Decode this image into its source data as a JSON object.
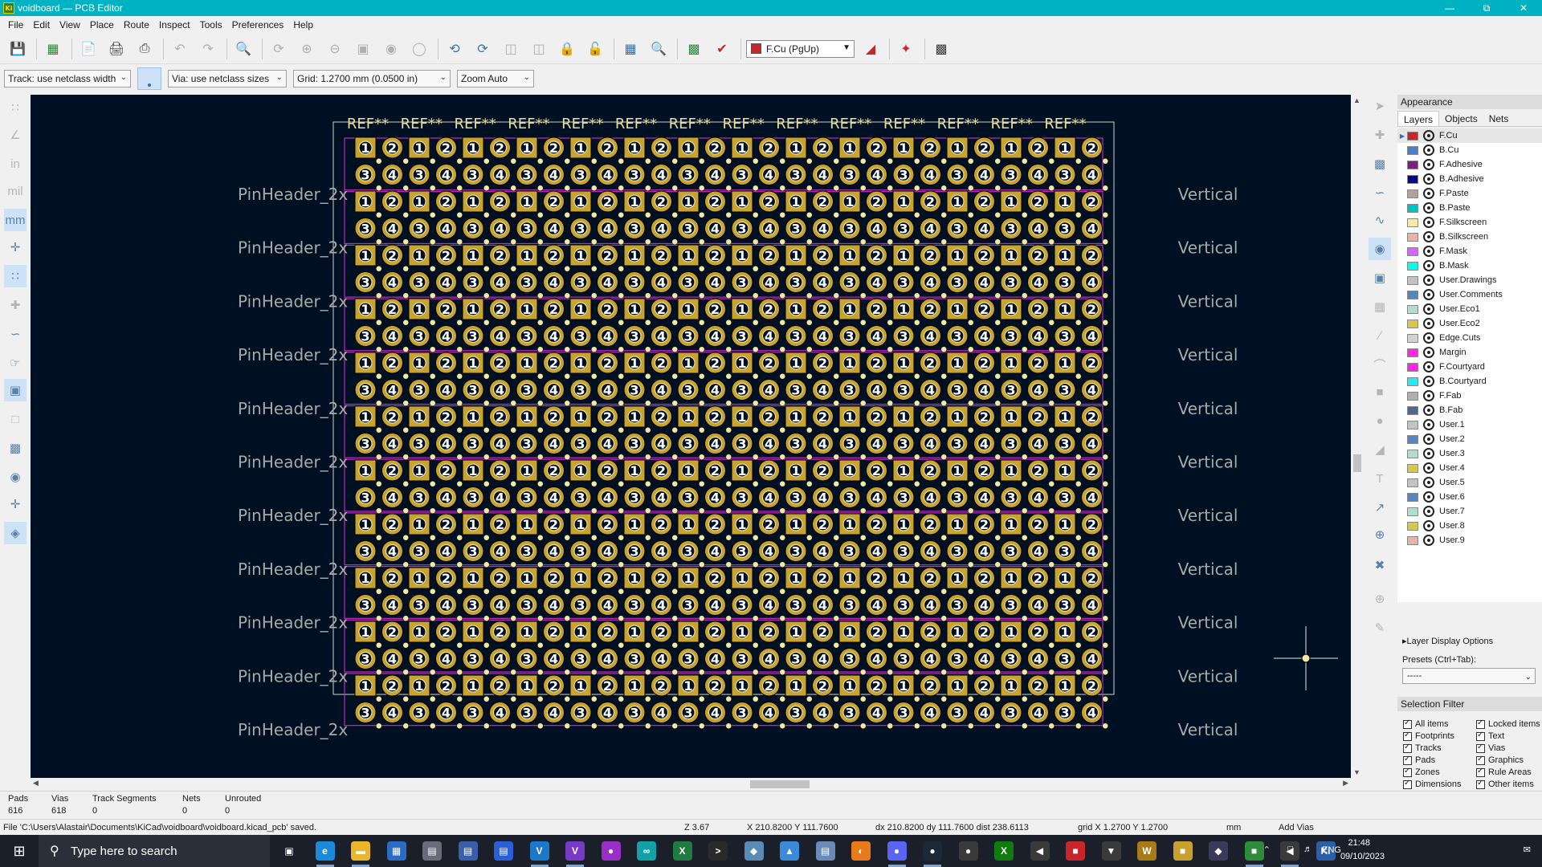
{
  "window": {
    "title": "voidboard — PCB Editor",
    "app_icon": "kicad-pcb-icon"
  },
  "menu": [
    "File",
    "Edit",
    "View",
    "Place",
    "Route",
    "Inspect",
    "Tools",
    "Preferences",
    "Help"
  ],
  "toolbar": {
    "layer_selector": "F.Cu (PgUp)"
  },
  "toolbar2": {
    "track_width": "Track: use netclass width",
    "via_size": "Via: use netclass sizes",
    "grid": "Grid: 1.2700 mm (0.0500 in)",
    "zoom": "Zoom Auto"
  },
  "board": {
    "ref_label": "REF**",
    "row_label_left": "PinHeader_2x",
    "row_label_right": "Vertical",
    "pin_numbers": [
      "1",
      "2",
      "3",
      "4"
    ],
    "colors": {
      "background": "#001023",
      "copper": "#c8a330",
      "silkscreen": "#e8dc9a",
      "courtyard": "#c02cc0",
      "fab_text": "#a8a8a8"
    }
  },
  "appearance": {
    "title": "Appearance",
    "tabs": [
      "Layers",
      "Objects",
      "Nets"
    ],
    "active_tab": "Layers",
    "layers": [
      {
        "name": "F.Cu",
        "color": "#c8262a"
      },
      {
        "name": "B.Cu",
        "color": "#4d7fc4"
      },
      {
        "name": "F.Adhesive",
        "color": "#841c80"
      },
      {
        "name": "B.Adhesive",
        "color": "#000d80"
      },
      {
        "name": "F.Paste",
        "color": "#b4a09c"
      },
      {
        "name": "B.Paste",
        "color": "#00c2c2"
      },
      {
        "name": "F.Silkscreen",
        "color": "#f2eda1"
      },
      {
        "name": "B.Silkscreen",
        "color": "#e8b2a7"
      },
      {
        "name": "F.Mask",
        "color": "#d864ff"
      },
      {
        "name": "B.Mask",
        "color": "#02ffee"
      },
      {
        "name": "User.Drawings",
        "color": "#c2c2c2"
      },
      {
        "name": "User.Comments",
        "color": "#5984c4"
      },
      {
        "name": "User.Eco1",
        "color": "#b4dbd2"
      },
      {
        "name": "User.Eco2",
        "color": "#d8c84a"
      },
      {
        "name": "Edge.Cuts",
        "color": "#d0d2cd"
      },
      {
        "name": "Margin",
        "color": "#ff26e2"
      },
      {
        "name": "F.Courtyard",
        "color": "#ff26e2"
      },
      {
        "name": "B.Courtyard",
        "color": "#26e9ff"
      },
      {
        "name": "F.Fab",
        "color": "#afafaf"
      },
      {
        "name": "B.Fab",
        "color": "#58658a"
      },
      {
        "name": "User.1",
        "color": "#c2c2c2"
      },
      {
        "name": "User.2",
        "color": "#5984c4"
      },
      {
        "name": "User.3",
        "color": "#b4dbd2"
      },
      {
        "name": "User.4",
        "color": "#d8c84a"
      },
      {
        "name": "User.5",
        "color": "#c2c2c2"
      },
      {
        "name": "User.6",
        "color": "#5984c4"
      },
      {
        "name": "User.7",
        "color": "#b4dbd2"
      },
      {
        "name": "User.8",
        "color": "#d8c84a"
      },
      {
        "name": "User.9",
        "color": "#e8b2a7"
      }
    ],
    "layer_display_options": "Layer Display Options",
    "presets_label": "Presets (Ctrl+Tab):",
    "presets_value": "-----"
  },
  "selection_filter": {
    "title": "Selection Filter",
    "left": [
      "All items",
      "Footprints",
      "Tracks",
      "Pads",
      "Zones",
      "Dimensions"
    ],
    "right": [
      "Locked items",
      "Text",
      "Vias",
      "Graphics",
      "Rule Areas",
      "Other items"
    ]
  },
  "stats": {
    "pads_label": "Pads",
    "pads": "616",
    "vias_label": "Vias",
    "vias": "618",
    "tracks_label": "Track Segments",
    "tracks": "0",
    "nets_label": "Nets",
    "nets": "0",
    "unrouted_label": "Unrouted",
    "unrouted": "0"
  },
  "status": {
    "message": "File 'C:\\Users\\Alastair\\Documents\\KiCad\\voidboard\\voidboard.kicad_pcb' saved.",
    "zoom": "Z 3.67",
    "cursor": "X 210.8200  Y 111.7600",
    "delta": "dx 210.8200  dy 111.7600  dist 238.6113",
    "grid": "grid X 1.2700  Y 1.2700",
    "units": "mm",
    "tool": "Add Vias"
  },
  "taskbar": {
    "search_placeholder": "Type here to search",
    "lang": "ENG",
    "time": "21:48",
    "date": "09/10/2023"
  }
}
